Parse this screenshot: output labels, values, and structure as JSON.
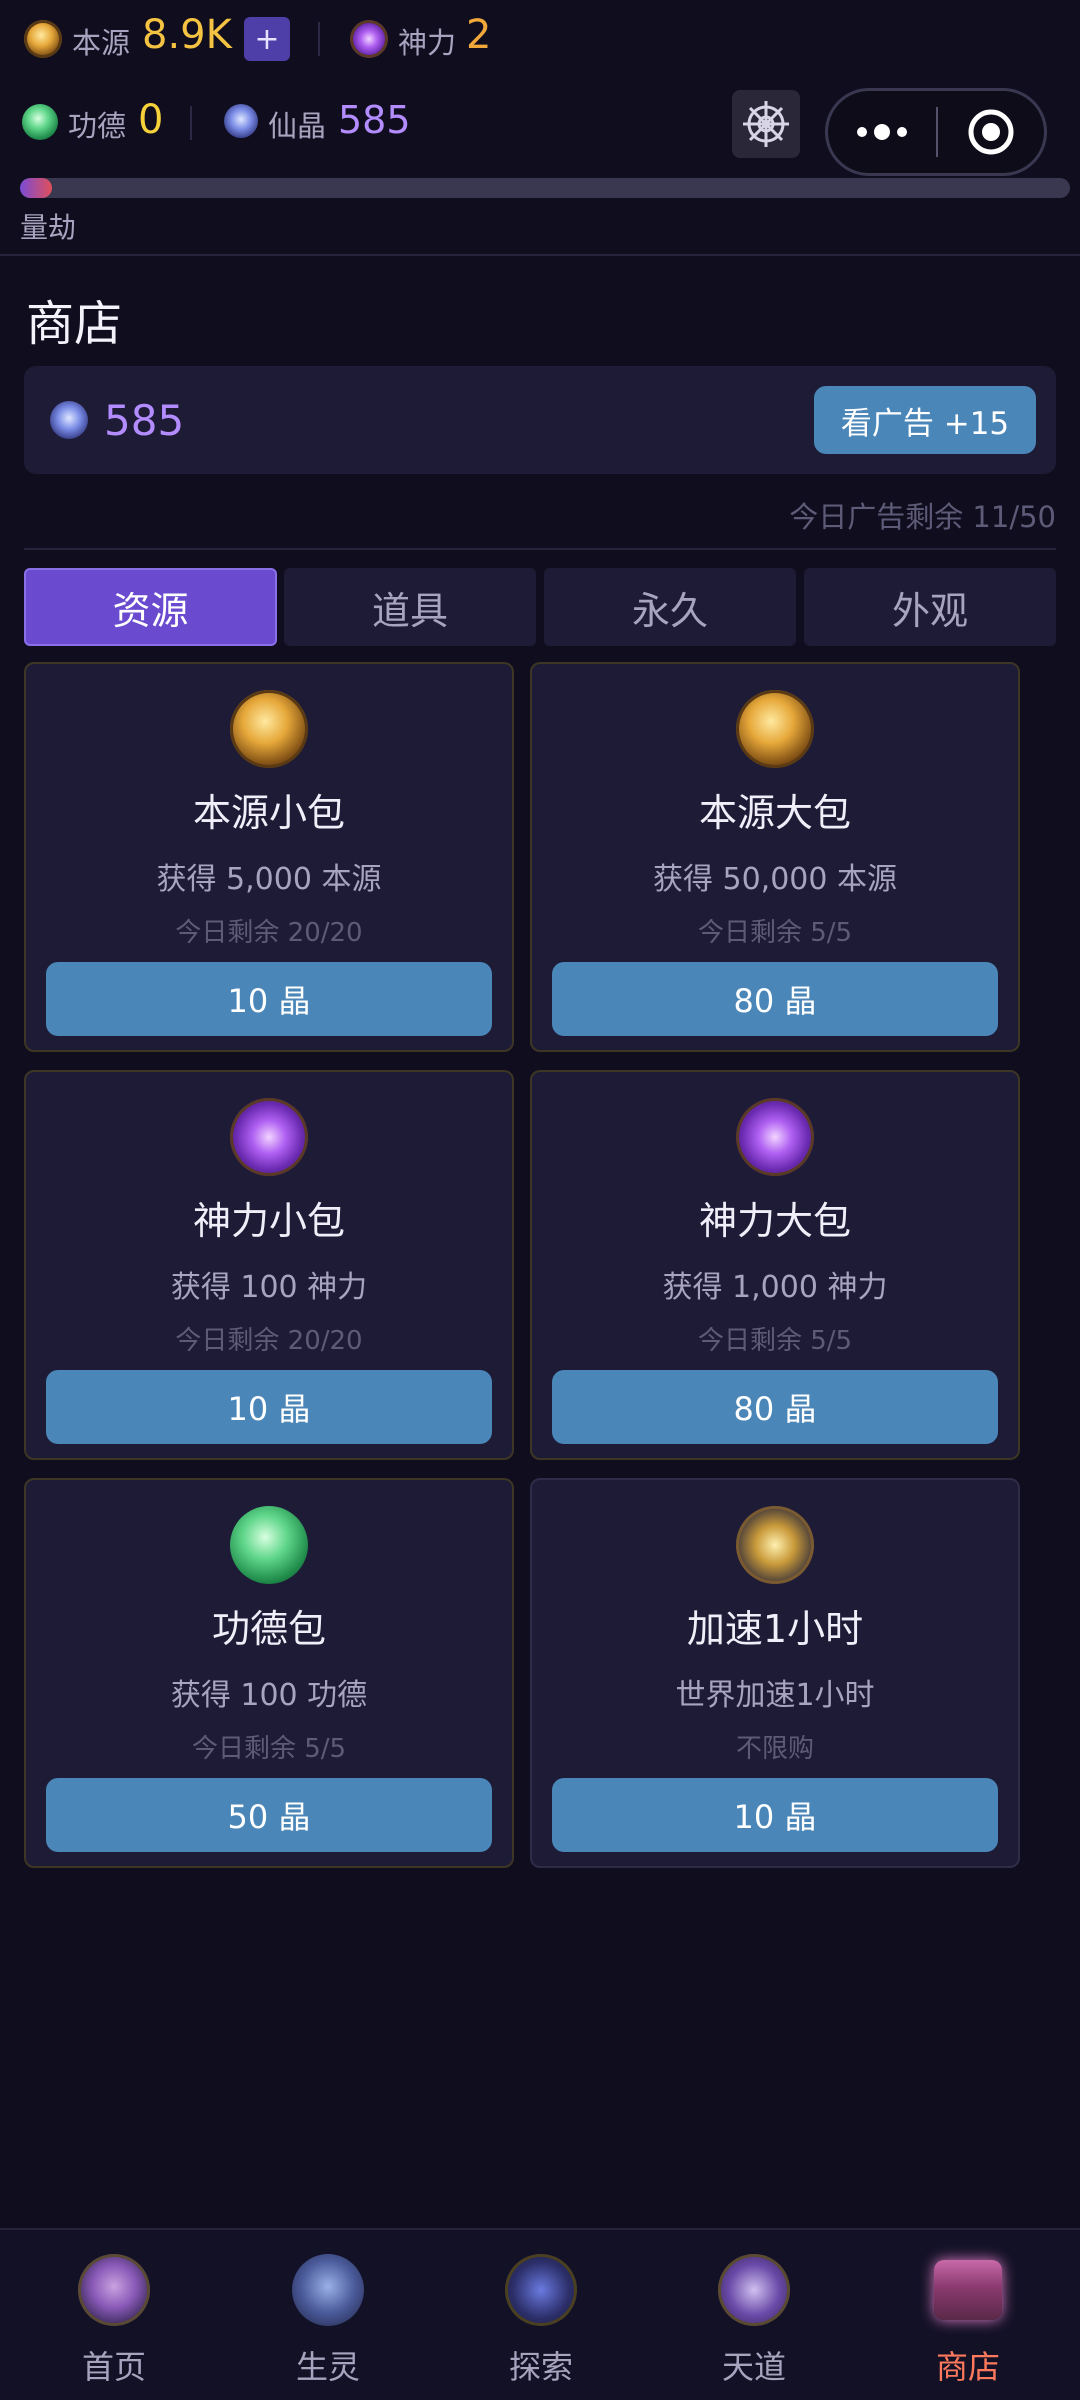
{
  "header": {
    "benyuan": {
      "label": "本源",
      "value": "8.9K"
    },
    "add_label": "+",
    "shenli": {
      "label": "神力",
      "value": "2"
    },
    "gongde": {
      "label": "功德",
      "value": "0"
    },
    "xianjing": {
      "label": "仙晶",
      "value": "585"
    },
    "liangjie_label": "量劫",
    "liangjie_progress": 0.03
  },
  "shop": {
    "title": "商店",
    "balance": "585",
    "ad_button": "看广告 +15",
    "ad_remaining": "今日广告剩余 11/50",
    "tabs": [
      "资源",
      "道具",
      "永久",
      "外观"
    ],
    "active_tab": 0,
    "items": [
      {
        "name": "本源小包",
        "desc": "获得 5,000 本源",
        "limit": "今日剩余 20/20",
        "price": "10 晶",
        "icon": "benyuan-icon"
      },
      {
        "name": "本源大包",
        "desc": "获得 50,000 本源",
        "limit": "今日剩余 5/5",
        "price": "80 晶",
        "icon": "benyuan-icon"
      },
      {
        "name": "神力小包",
        "desc": "获得 100 神力",
        "limit": "今日剩余 20/20",
        "price": "10 晶",
        "icon": "shenli-icon"
      },
      {
        "name": "神力大包",
        "desc": "获得 1,000 神力",
        "limit": "今日剩余 5/5",
        "price": "80 晶",
        "icon": "shenli-icon"
      },
      {
        "name": "功德包",
        "desc": "获得 100 功德",
        "limit": "今日剩余 5/5",
        "price": "50 晶",
        "icon": "gongde-icon"
      },
      {
        "name": "加速1小时",
        "desc": "世界加速1小时",
        "limit": "不限购",
        "price": "10 晶",
        "icon": "clock-icon"
      }
    ]
  },
  "nav": {
    "items": [
      "首页",
      "生灵",
      "探索",
      "天道",
      "商店"
    ],
    "active": 4
  },
  "colors": {
    "accent": "#6a4bd0",
    "button": "#4a86b8",
    "gold": "#f5c342",
    "crystal": "#b38cff",
    "nav_active": "#ff7a5c"
  }
}
